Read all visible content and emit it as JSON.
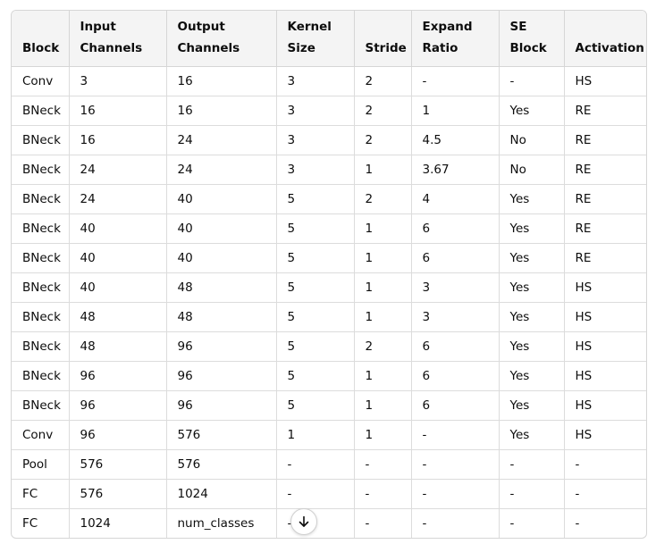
{
  "table": {
    "headers": [
      [
        "Block"
      ],
      [
        "Input",
        "Channels"
      ],
      [
        "Output",
        "Channels"
      ],
      [
        "Kernel",
        "Size"
      ],
      [
        "Stride"
      ],
      [
        "Expand",
        "Ratio"
      ],
      [
        "SE",
        "Block"
      ],
      [
        "Activation"
      ]
    ],
    "rows": [
      [
        "Conv",
        "3",
        "16",
        "3",
        "2",
        "-",
        "-",
        "HS"
      ],
      [
        "BNeck",
        "16",
        "16",
        "3",
        "2",
        "1",
        "Yes",
        "RE"
      ],
      [
        "BNeck",
        "16",
        "24",
        "3",
        "2",
        "4.5",
        "No",
        "RE"
      ],
      [
        "BNeck",
        "24",
        "24",
        "3",
        "1",
        "3.67",
        "No",
        "RE"
      ],
      [
        "BNeck",
        "24",
        "40",
        "5",
        "2",
        "4",
        "Yes",
        "RE"
      ],
      [
        "BNeck",
        "40",
        "40",
        "5",
        "1",
        "6",
        "Yes",
        "RE"
      ],
      [
        "BNeck",
        "40",
        "40",
        "5",
        "1",
        "6",
        "Yes",
        "RE"
      ],
      [
        "BNeck",
        "40",
        "48",
        "5",
        "1",
        "3",
        "Yes",
        "HS"
      ],
      [
        "BNeck",
        "48",
        "48",
        "5",
        "1",
        "3",
        "Yes",
        "HS"
      ],
      [
        "BNeck",
        "48",
        "96",
        "5",
        "2",
        "6",
        "Yes",
        "HS"
      ],
      [
        "BNeck",
        "96",
        "96",
        "5",
        "1",
        "6",
        "Yes",
        "HS"
      ],
      [
        "BNeck",
        "96",
        "96",
        "5",
        "1",
        "6",
        "Yes",
        "HS"
      ],
      [
        "Conv",
        "96",
        "576",
        "1",
        "1",
        "-",
        "Yes",
        "HS"
      ],
      [
        "Pool",
        "576",
        "576",
        "-",
        "-",
        "-",
        "-",
        "-"
      ],
      [
        "FC",
        "576",
        "1024",
        "-",
        "-",
        "-",
        "-",
        "-"
      ],
      [
        "FC",
        "1024",
        "num_classes",
        "-",
        "-",
        "-",
        "-",
        "-"
      ]
    ]
  },
  "scroll_button": {
    "icon": "arrow-down-icon"
  }
}
